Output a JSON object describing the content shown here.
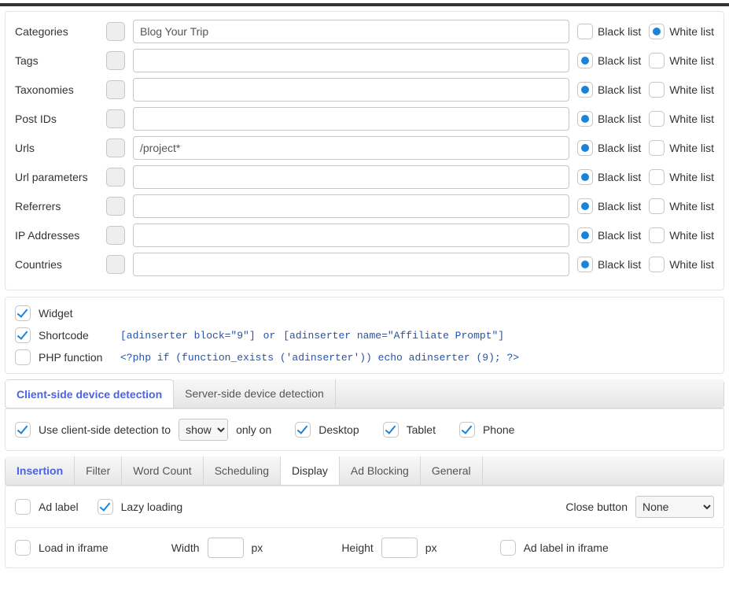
{
  "labels": {
    "black_list": "Black list",
    "white_list": "White list"
  },
  "filters": [
    {
      "id": "categories",
      "label": "Categories",
      "value": "Blog Your Trip",
      "selected": "white"
    },
    {
      "id": "tags",
      "label": "Tags",
      "value": "",
      "selected": "black"
    },
    {
      "id": "taxonomies",
      "label": "Taxonomies",
      "value": "",
      "selected": "black"
    },
    {
      "id": "post-ids",
      "label": "Post IDs",
      "value": "",
      "selected": "black"
    },
    {
      "id": "urls",
      "label": "Urls",
      "value": "/project*",
      "selected": "black"
    },
    {
      "id": "url-parameters",
      "label": "Url parameters",
      "value": "",
      "selected": "black"
    },
    {
      "id": "referrers",
      "label": "Referrers",
      "value": "",
      "selected": "black"
    },
    {
      "id": "ip-addresses",
      "label": "IP Addresses",
      "value": "",
      "selected": "black"
    },
    {
      "id": "countries",
      "label": "Countries",
      "value": "",
      "selected": "black"
    }
  ],
  "options": {
    "widget": {
      "label": "Widget",
      "checked": true
    },
    "shortcode": {
      "label": "Shortcode",
      "checked": true,
      "code1": "[adinserter block=\"9\"]",
      "or": "or",
      "code2": "[adinserter name=\"Affiliate Prompt\"]"
    },
    "php": {
      "label": "PHP function",
      "checked": false,
      "code": "<?php if (function_exists ('adinserter')) echo adinserter (9); ?>"
    }
  },
  "device_tabs": {
    "client": "Client-side device detection",
    "server": "Server-side device detection"
  },
  "client_detection": {
    "use_label_pre": "Use client-side detection to",
    "show_options": [
      "show"
    ],
    "show_value": "show",
    "use_label_post": "only on",
    "desktop": "Desktop",
    "tablet": "Tablet",
    "phone": "Phone",
    "use_checked": true,
    "desktop_checked": true,
    "tablet_checked": true,
    "phone_checked": true
  },
  "main_tabs": [
    "Insertion",
    "Filter",
    "Word Count",
    "Scheduling",
    "Display",
    "Ad Blocking",
    "General"
  ],
  "main_tab_active": "Display",
  "display": {
    "ad_label": "Ad label",
    "ad_label_checked": false,
    "lazy": "Lazy loading",
    "lazy_checked": true,
    "close_label": "Close button",
    "close_options": [
      "None"
    ],
    "close_value": "None",
    "iframe": "Load in iframe",
    "iframe_checked": false,
    "width_label": "Width",
    "width_value": "",
    "height_label": "Height",
    "height_value": "",
    "px": "px",
    "ad_label_iframe": "Ad label in iframe",
    "ad_label_iframe_checked": false
  }
}
